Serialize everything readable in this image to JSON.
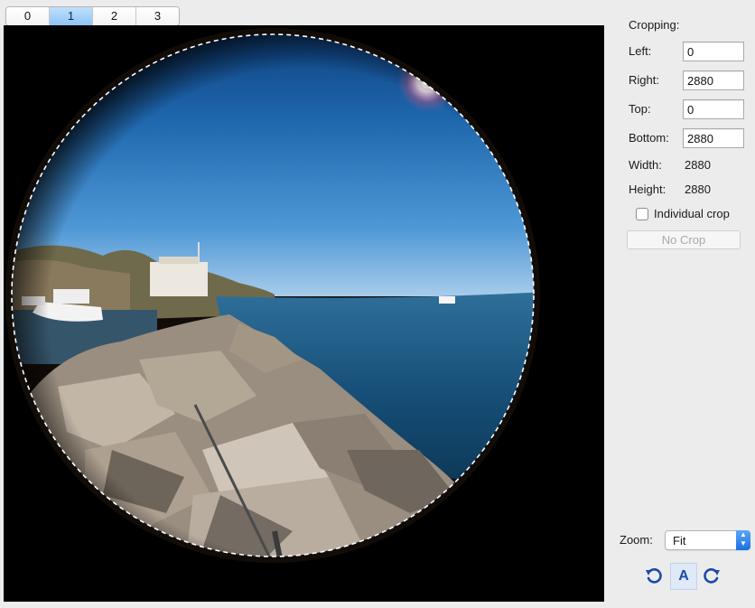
{
  "tabs": [
    {
      "label": "0",
      "active": false
    },
    {
      "label": "1",
      "active": true
    },
    {
      "label": "2",
      "active": false
    },
    {
      "label": "3",
      "active": false
    }
  ],
  "cropping": {
    "heading": "Cropping:",
    "left": {
      "label": "Left:",
      "value": "0"
    },
    "right": {
      "label": "Right:",
      "value": "2880"
    },
    "top": {
      "label": "Top:",
      "value": "0"
    },
    "bottom": {
      "label": "Bottom:",
      "value": "2880"
    },
    "width": {
      "label": "Width:",
      "value": "2880"
    },
    "height": {
      "label": "Height:",
      "value": "2880"
    },
    "individual_crop_label": "Individual crop",
    "individual_crop_checked": false,
    "no_crop_label": "No Crop"
  },
  "zoom": {
    "label": "Zoom:",
    "value": "Fit"
  },
  "toolbar": {
    "rotate_left_icon": "rotate-ccw-icon",
    "auto_label": "A",
    "rotate_right_icon": "rotate-cw-icon"
  },
  "colors": {
    "accent": "#1b71e3",
    "tab_active": "#8ec5f5",
    "icon_blue": "#1b4aa8"
  }
}
